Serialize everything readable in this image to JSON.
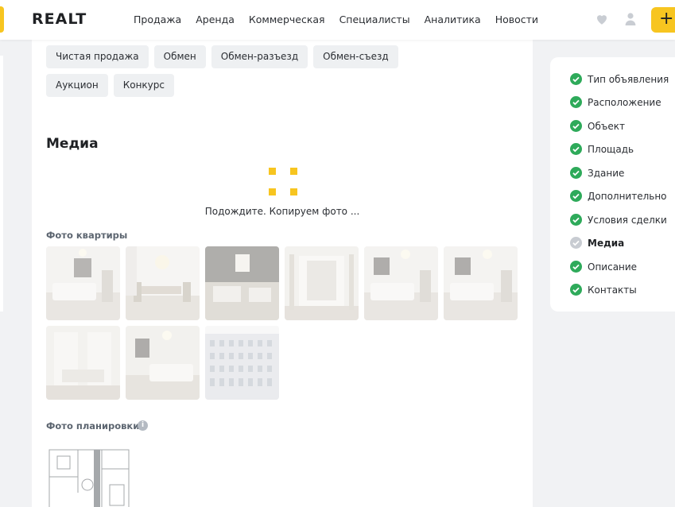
{
  "header": {
    "logo": "REALT",
    "nav": [
      "Продажа",
      "Аренда",
      "Коммерческая",
      "Специалисты",
      "Аналитика",
      "Новости"
    ],
    "icons": [
      "heart-icon",
      "user-icon"
    ],
    "add_label": "+",
    "accent_color": "#f7c520"
  },
  "deal_types": {
    "row1": [
      "Чистая продажа",
      "Обмен",
      "Обмен-разъезд",
      "Обмен-съезд"
    ],
    "row2": [
      "Аукцион",
      "Конкурс"
    ]
  },
  "media": {
    "title": "Медиа",
    "loading_text": "Подождите. Копируем фото ...",
    "apartment_photos_title": "Фото квартиры",
    "apartment_photos": [
      "living-room-photo",
      "dining-room-photo",
      "living-room-photo",
      "bathroom-photo",
      "living-room-photo",
      "living-room-photo",
      "bathroom-photo",
      "bedroom-photo",
      "building-facade-photo"
    ],
    "floorplan_title": "Фото планировки",
    "info_icon": "i"
  },
  "steps": [
    {
      "label": "Тип объявления",
      "done": true
    },
    {
      "label": "Расположение",
      "done": true
    },
    {
      "label": "Объект",
      "done": true
    },
    {
      "label": "Площадь",
      "done": true
    },
    {
      "label": "Здание",
      "done": true
    },
    {
      "label": "Дополнительно",
      "done": true
    },
    {
      "label": "Условия сделки",
      "done": true
    },
    {
      "label": "Медиа",
      "done": false,
      "active": true
    },
    {
      "label": "Описание",
      "done": true
    },
    {
      "label": "Контакты",
      "done": true
    }
  ],
  "colors": {
    "check": "#2eaa5a",
    "pending": "#c8ccd2"
  }
}
